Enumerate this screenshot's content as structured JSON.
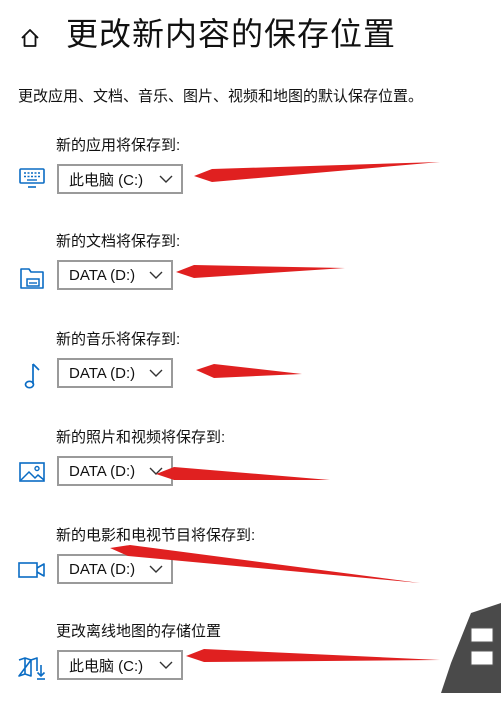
{
  "page": {
    "title": "更改新内容的保存位置",
    "description": "更改应用、文档、音乐、图片、视频和地图的默认保存位置。"
  },
  "settings": [
    {
      "label": "新的应用将保存到:",
      "value": "此电脑 (C:)",
      "icon": "monitor-keyboard-icon"
    },
    {
      "label": "新的文档将保存到:",
      "value": "DATA (D:)",
      "icon": "drive-folder-icon"
    },
    {
      "label": "新的音乐将保存到:",
      "value": "DATA (D:)",
      "icon": "music-note-icon"
    },
    {
      "label": "新的照片和视频将保存到:",
      "value": "DATA (D:)",
      "icon": "picture-icon"
    },
    {
      "label": "新的电影和电视节目将保存到:",
      "value": "DATA (D:)",
      "icon": "video-camera-icon"
    },
    {
      "label": "更改离线地图的存储位置",
      "value": "此电脑 (C:)",
      "icon": "map-download-icon"
    }
  ],
  "colors": {
    "accent": "#0a6cc4",
    "annotation_arrow": "#e02020",
    "dropdown_border": "#9a9a9a"
  },
  "icons": {
    "home": "home-icon",
    "chevron": "chevron-down-icon"
  }
}
